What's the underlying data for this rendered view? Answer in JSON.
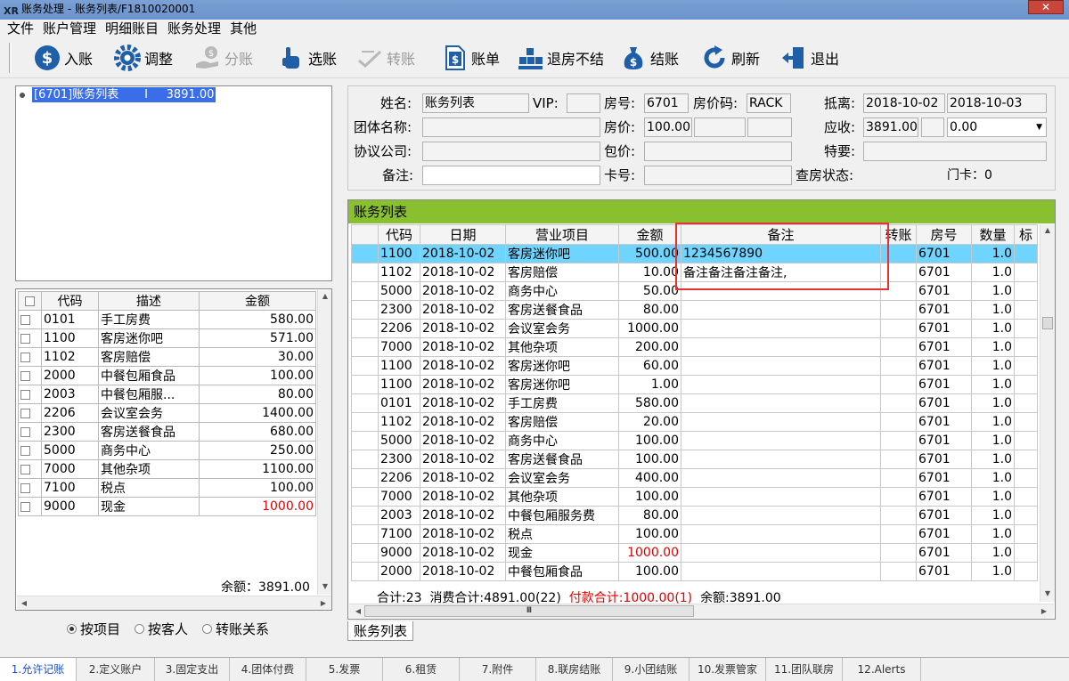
{
  "window": {
    "logo": "XR",
    "title": "账务处理 - 账务列表/F1810020001",
    "close": "✕"
  },
  "menu": [
    "文件",
    "账户管理",
    "明细账目",
    "账务处理",
    "其他"
  ],
  "toolbar": [
    {
      "label": "入账",
      "icon": "dollar-icon",
      "enabled": true
    },
    {
      "label": "调整",
      "icon": "gear-icon",
      "enabled": true
    },
    {
      "label": "分账",
      "icon": "hand-coin-icon",
      "enabled": false
    },
    {
      "label": "选账",
      "icon": "pointer-hand-icon",
      "enabled": true
    },
    {
      "label": "转账",
      "icon": "transfer-icon",
      "enabled": false
    },
    {
      "label": "账单",
      "icon": "bill-icon",
      "enabled": true
    },
    {
      "label": "退房不结",
      "icon": "blocks-icon",
      "enabled": true
    },
    {
      "label": "结账",
      "icon": "money-bag-icon",
      "enabled": true
    },
    {
      "label": "刷新",
      "icon": "refresh-icon",
      "enabled": true
    },
    {
      "label": "退出",
      "icon": "exit-icon",
      "enabled": true
    }
  ],
  "tree": {
    "item": "[6701]账务列表       I     3891.00"
  },
  "left_grid": {
    "headers": [
      "代码",
      "描述",
      "金额"
    ],
    "rows": [
      {
        "code": "0101",
        "desc": "手工房费",
        "amount": "580.00",
        "red": false
      },
      {
        "code": "1100",
        "desc": "客房迷你吧",
        "amount": "571.00",
        "red": false
      },
      {
        "code": "1102",
        "desc": "客房赔偿",
        "amount": "30.00",
        "red": false
      },
      {
        "code": "2000",
        "desc": "中餐包厢食品",
        "amount": "100.00",
        "red": false
      },
      {
        "code": "2003",
        "desc": "中餐包厢服...",
        "amount": "80.00",
        "red": false
      },
      {
        "code": "2206",
        "desc": "会议室会务",
        "amount": "1400.00",
        "red": false
      },
      {
        "code": "2300",
        "desc": "客房送餐食品",
        "amount": "680.00",
        "red": false
      },
      {
        "code": "5000",
        "desc": "商务中心",
        "amount": "250.00",
        "red": false
      },
      {
        "code": "7000",
        "desc": "其他杂项",
        "amount": "1100.00",
        "red": false
      },
      {
        "code": "7100",
        "desc": "税点",
        "amount": "100.00",
        "red": false
      },
      {
        "code": "9000",
        "desc": "现金",
        "amount": "1000.00",
        "red": true
      }
    ],
    "balance": "余额：3891.00"
  },
  "radios": [
    {
      "label": "按项目",
      "checked": true
    },
    {
      "label": "按客人",
      "checked": false
    },
    {
      "label": "转账关系",
      "checked": false
    }
  ],
  "info": {
    "name_label": "姓名:",
    "name": "账务列表",
    "vip_label": "VIP:",
    "vip": "",
    "room_label": "房号:",
    "room": "6701",
    "rate_code_label": "房价码:",
    "rate_code": "RACK",
    "stay_label": "抵离:",
    "arrive": "2018-10-02",
    "depart": "2018-10-03",
    "group_label": "团体名称:",
    "group": "",
    "price_label": "房价:",
    "price": "100.00",
    "due_label": "应收:",
    "due": "3891.00",
    "due2": "0.00",
    "company_label": "协议公司:",
    "company": "",
    "package_label": "包价:",
    "package": "",
    "special_label": "特要:",
    "special": "",
    "remark_label": "备注:",
    "remark": "",
    "card_label": "卡号:",
    "card": "",
    "check_label": "查房状态:",
    "door_label": "门卡：0"
  },
  "ledger": {
    "title": "账务列表",
    "headers": [
      "代码",
      "日期",
      "营业项目",
      "金额",
      "备注",
      "转账",
      "房号",
      "数量",
      "标"
    ],
    "rows": [
      {
        "code": "1100",
        "date": "2018-10-02",
        "item": "客房迷你吧",
        "amount": "500.00",
        "remark": "1234567890",
        "room": "6701",
        "qty": "1.0",
        "red": false,
        "selected": true
      },
      {
        "code": "1102",
        "date": "2018-10-02",
        "item": "客房赔偿",
        "amount": "10.00",
        "remark": "备注备注备注备注,",
        "room": "6701",
        "qty": "1.0",
        "red": false,
        "selected": false
      },
      {
        "code": "5000",
        "date": "2018-10-02",
        "item": "商务中心",
        "amount": "50.00",
        "remark": "",
        "room": "6701",
        "qty": "1.0",
        "red": false,
        "selected": false
      },
      {
        "code": "2300",
        "date": "2018-10-02",
        "item": "客房送餐食品",
        "amount": "80.00",
        "remark": "",
        "room": "6701",
        "qty": "1.0",
        "red": false,
        "selected": false
      },
      {
        "code": "2206",
        "date": "2018-10-02",
        "item": "会议室会务",
        "amount": "1000.00",
        "remark": "",
        "room": "6701",
        "qty": "1.0",
        "red": false,
        "selected": false
      },
      {
        "code": "7000",
        "date": "2018-10-02",
        "item": "其他杂项",
        "amount": "200.00",
        "remark": "",
        "room": "6701",
        "qty": "1.0",
        "red": false,
        "selected": false
      },
      {
        "code": "1100",
        "date": "2018-10-02",
        "item": "客房迷你吧",
        "amount": "60.00",
        "remark": "",
        "room": "6701",
        "qty": "1.0",
        "red": false,
        "selected": false
      },
      {
        "code": "1100",
        "date": "2018-10-02",
        "item": "客房迷你吧",
        "amount": "1.00",
        "remark": "",
        "room": "6701",
        "qty": "1.0",
        "red": false,
        "selected": false
      },
      {
        "code": "0101",
        "date": "2018-10-02",
        "item": "手工房费",
        "amount": "580.00",
        "remark": "",
        "room": "6701",
        "qty": "1.0",
        "red": false,
        "selected": false
      },
      {
        "code": "1102",
        "date": "2018-10-02",
        "item": "客房赔偿",
        "amount": "20.00",
        "remark": "",
        "room": "6701",
        "qty": "1.0",
        "red": false,
        "selected": false
      },
      {
        "code": "5000",
        "date": "2018-10-02",
        "item": "商务中心",
        "amount": "100.00",
        "remark": "",
        "room": "6701",
        "qty": "1.0",
        "red": false,
        "selected": false
      },
      {
        "code": "2300",
        "date": "2018-10-02",
        "item": "客房送餐食品",
        "amount": "100.00",
        "remark": "",
        "room": "6701",
        "qty": "1.0",
        "red": false,
        "selected": false
      },
      {
        "code": "2206",
        "date": "2018-10-02",
        "item": "会议室会务",
        "amount": "400.00",
        "remark": "",
        "room": "6701",
        "qty": "1.0",
        "red": false,
        "selected": false
      },
      {
        "code": "7000",
        "date": "2018-10-02",
        "item": "其他杂项",
        "amount": "100.00",
        "remark": "",
        "room": "6701",
        "qty": "1.0",
        "red": false,
        "selected": false
      },
      {
        "code": "2003",
        "date": "2018-10-02",
        "item": "中餐包厢服务费",
        "amount": "80.00",
        "remark": "",
        "room": "6701",
        "qty": "1.0",
        "red": false,
        "selected": false
      },
      {
        "code": "7100",
        "date": "2018-10-02",
        "item": "税点",
        "amount": "100.00",
        "remark": "",
        "room": "6701",
        "qty": "1.0",
        "red": false,
        "selected": false
      },
      {
        "code": "9000",
        "date": "2018-10-02",
        "item": "现金",
        "amount": "1000.00",
        "remark": "",
        "room": "6701",
        "qty": "1.0",
        "red": true,
        "selected": false
      },
      {
        "code": "2000",
        "date": "2018-10-02",
        "item": "中餐包厢食品",
        "amount": "100.00",
        "remark": "",
        "room": "6701",
        "qty": "1.0",
        "red": false,
        "selected": false
      }
    ],
    "total_count": "合计:23",
    "consume_total": "消费合计:4891.00(22)",
    "payment_total": "付款合计:1000.00(1)",
    "balance": "余额:3891.00",
    "hscroll_thumb": "Ⅲ",
    "tab": "账务列表"
  },
  "status_tabs": [
    {
      "label": "1.允许记账",
      "active": true
    },
    {
      "label": "2.定义账户",
      "active": false
    },
    {
      "label": "3.固定支出",
      "active": false
    },
    {
      "label": "4.团体付费",
      "active": false
    },
    {
      "label": "5.发票",
      "active": false
    },
    {
      "label": "6.租赁",
      "active": false
    },
    {
      "label": "7.附件",
      "active": false
    },
    {
      "label": "8.联房结账",
      "active": false
    },
    {
      "label": "9.小团结账",
      "active": false
    },
    {
      "label": "10.发票管家",
      "active": false
    },
    {
      "label": "11.团队联房",
      "active": false
    },
    {
      "label": "12.Alerts",
      "active": false
    }
  ],
  "colors": {
    "accent": "#88c030",
    "selection": "#6fd4ff",
    "tree_selection": "#3a6ee8",
    "negative": "#e00000",
    "highlight_box": "#e83030"
  }
}
